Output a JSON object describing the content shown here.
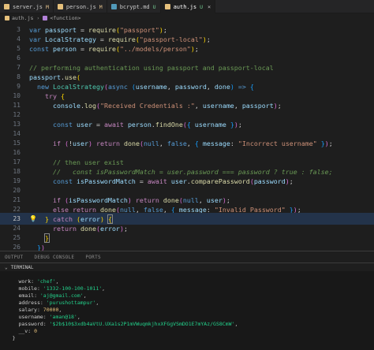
{
  "tabs": [
    {
      "label": "server.js",
      "badge": "M",
      "icon_color": "#e5c07b",
      "active": false,
      "icon": "js-file-icon"
    },
    {
      "label": "person.js",
      "badge": "M",
      "icon_color": "#e5c07b",
      "active": false,
      "icon": "js-file-icon"
    },
    {
      "label": "bcrypt.md",
      "badge": "U",
      "icon_color": "#519aba",
      "active": false,
      "icon": "markdown-file-icon"
    },
    {
      "label": "auth.js",
      "badge": "U",
      "icon_color": "#e5c07b",
      "active": true,
      "icon": "js-file-icon"
    }
  ],
  "breadcrumb": {
    "file": "auth.js",
    "symbol": "<function>"
  },
  "editor": {
    "current_line": 23,
    "lines": [
      {
        "n": "3"
      },
      {
        "n": "4"
      },
      {
        "n": "5"
      },
      {
        "n": "6"
      },
      {
        "n": "7"
      },
      {
        "n": "8"
      },
      {
        "n": "9"
      },
      {
        "n": "10"
      },
      {
        "n": "11"
      },
      {
        "n": "12"
      },
      {
        "n": "13"
      },
      {
        "n": "14"
      },
      {
        "n": "15"
      },
      {
        "n": "16"
      },
      {
        "n": "17"
      },
      {
        "n": "18"
      },
      {
        "n": "19"
      },
      {
        "n": "20"
      },
      {
        "n": "21"
      },
      {
        "n": "22"
      },
      {
        "n": "23"
      },
      {
        "n": "24"
      },
      {
        "n": "25"
      },
      {
        "n": "26"
      }
    ],
    "code": {
      "l3_kw": "var",
      "l3_var": "passport",
      "l3_eq": " = ",
      "l3_fn": "require",
      "l3_str": "\"passport\"",
      "l4_kw": "var",
      "l4_var": "LocalStrategy",
      "l4_eq": " = ",
      "l4_fn": "require",
      "l4_str": "\"passport-local\"",
      "l5_kw": "const",
      "l5_var": "person",
      "l5_eq": " = ",
      "l5_fn": "require",
      "l5_str": "\"../models/person\"",
      "l7_cmt": "// performing authentication using passport and passport-local",
      "l8_var": "passport",
      "l8_fn": "use",
      "l9_kw": "new",
      "l9_cls": "LocalStrategy",
      "l9_async": "async",
      "l9_p1": "username",
      "l9_p2": "password",
      "l9_p3": "done",
      "l9_arrow": "=>",
      "l10_kw": "try",
      "l11_var": "console",
      "l11_fn": "log",
      "l11_str": "\"Received Credentials :\"",
      "l11_p2": "username",
      "l11_p3": "passport",
      "l13_kw": "const",
      "l13_var": "user",
      "l13_await": "await",
      "l13_obj": "person",
      "l13_fn": "findOne",
      "l13_arg": "username",
      "l15_if": "if",
      "l15_var": "user",
      "l15_ret": "return",
      "l15_fn": "done",
      "l15_null": "null",
      "l15_false": "false",
      "l15_key": "message",
      "l15_str": "\"Incorrect username\"",
      "l17_cmt": "// then user exist",
      "l18_cmt": "//   const isPasswordMatch = user.password === password ? true : false;",
      "l19_kw": "const",
      "l19_var": "isPasswordMatch",
      "l19_await": "await",
      "l19_obj": "user",
      "l19_fn": "comparePassword",
      "l19_arg": "password",
      "l21_if": "if",
      "l21_var": "isPasswordMatch",
      "l21_ret": "return",
      "l21_fn": "done",
      "l21_null": "null",
      "l21_arg": "user",
      "l22_else": "else",
      "l22_ret": "return",
      "l22_fn": "done",
      "l22_null": "null",
      "l22_false": "false",
      "l22_key": "message",
      "l22_str": "\"Invalid Password\"",
      "l23_catch": "catch",
      "l23_var": "error",
      "l24_ret": "return",
      "l24_fn": "done",
      "l24_var": "error"
    }
  },
  "panel": {
    "tabs": [
      "OUTPUT",
      "DEBUG CONSOLE",
      "PORTS"
    ],
    "active": "OUTPUT"
  },
  "terminal": {
    "header": "TERMINAL",
    "fields": [
      {
        "key": "work",
        "value": "'chef'",
        "kind": "str"
      },
      {
        "key": "mobile",
        "value": "'1332-100-100-1011'",
        "kind": "str"
      },
      {
        "key": "email",
        "value": "'aj@gmail.com'",
        "kind": "str"
      },
      {
        "key": "address",
        "value": "'purushottampur'",
        "kind": "str"
      },
      {
        "key": "salary",
        "value": "70000",
        "kind": "num"
      },
      {
        "key": "username",
        "value": "'aman@18'",
        "kind": "str"
      },
      {
        "key": "password",
        "value": "'$2b$10$3xdb4aVtU.UXa1s2P1mVWuqmkjhxXFGgVSmDO1E7mYAz/GS8CmW'",
        "kind": "str"
      },
      {
        "key": "__v",
        "value": "0",
        "kind": "num"
      }
    ],
    "close_brace": "}"
  }
}
